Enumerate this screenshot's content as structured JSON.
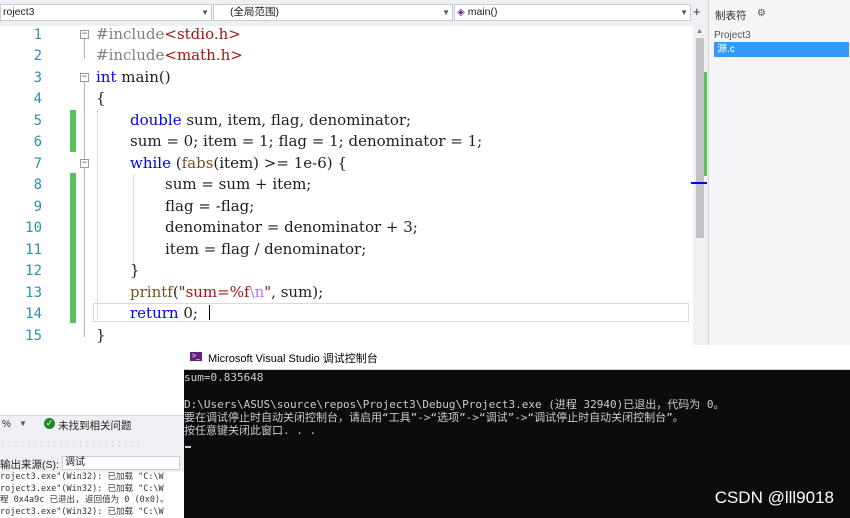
{
  "navbar": {
    "project_combo": "roject3",
    "scope_combo": "(全局范围)",
    "member_combo": "main()"
  },
  "solution_panel": {
    "title": "制表符",
    "project": "Project3",
    "file": "源.c"
  },
  "editor": {
    "line_numbers": [
      "1",
      "2",
      "3",
      "4",
      "5",
      "6",
      "7",
      "8",
      "9",
      "10",
      "11",
      "12",
      "13",
      "14",
      "15"
    ],
    "code": {
      "l1_directive": "#include",
      "l1_header": "<stdio.h>",
      "l2_directive": "#include",
      "l2_header": "<math.h>",
      "l3_kw": "int",
      "l3_rest": " main()",
      "l4": "{",
      "l5_kw": "double",
      "l5_rest": " sum, item, flag, denominator;",
      "l6_rest": "sum = 0; item = 1; flag = 1; denominator = 1;",
      "l7_kw": "while",
      "l7_open": " (",
      "l7_fn": "fabs",
      "l7_rest": "(item) >= 1e-6) {",
      "l8": "sum = sum + item;",
      "l9": "flag = -flag;",
      "l10": "denominator = denominator + 3;",
      "l11": "item = flag / denominator;",
      "l12": "}",
      "l13_fn": "printf",
      "l13_paren": "(",
      "l13_str_a": "\"sum=%f",
      "l13_esc": "\\n",
      "l13_str_b": "\"",
      "l13_rest": ", sum);",
      "l14_kw": "return",
      "l14_rest": " 0;",
      "l15": "}"
    },
    "fold_symbol": "−"
  },
  "status": {
    "zoom": "%",
    "issues": "未找到相关问题",
    "ok_icon": "✓"
  },
  "output_panel": {
    "source_label": "输出来源(S):",
    "source_value": "调试",
    "lines": [
      "roject3.exe\"(Win32): 已加载 \"C:\\W",
      "roject3.exe\"(Win32): 已加载 \"C:\\W",
      "程 0x4a9c 已退出, 返回值为 0 (0x0)。",
      "roject3.exe\"(Win32): 已加载 \"C:\\W"
    ]
  },
  "console": {
    "title": "Microsoft Visual Studio 调试控制台",
    "lines": [
      "sum=0.835648",
      "",
      "D:\\Users\\ASUS\\source\\repos\\Project3\\Debug\\Project3.exe (进程 32940)已退出，代码为 0。",
      "要在调试停止时自动关闭控制台，请启用“工具”->“选项”->“调试”->“调试停止时自动关闭控制台”。",
      "按任意键关闭此窗口. . ."
    ],
    "watermark": "CSDN @lll9018"
  },
  "colors": {
    "keyword": "#0000ff",
    "string": "#a31515",
    "line_number": "#2b91af",
    "change_bar": "#57c25a",
    "console_bg": "#0c0c0c"
  }
}
